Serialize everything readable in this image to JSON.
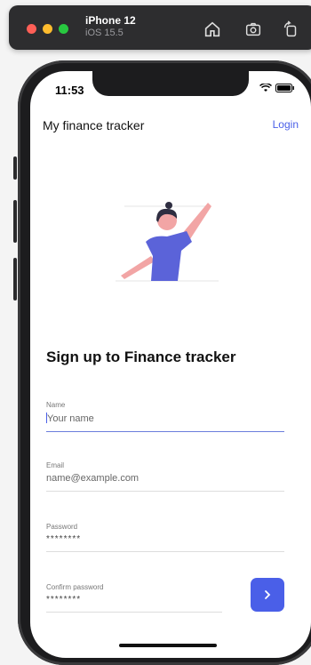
{
  "simulator": {
    "device_name": "iPhone 12",
    "os_version": "iOS 15.5",
    "toolbar_icons": [
      "home-icon",
      "screenshot-icon",
      "rotate-icon"
    ]
  },
  "status_bar": {
    "time": "11:53",
    "icons": [
      "wifi-icon",
      "battery-icon"
    ]
  },
  "header": {
    "title": "My finance tracker",
    "login_label": "Login"
  },
  "main": {
    "heading": "Sign up to Finance tracker",
    "fields": [
      {
        "label": "Name",
        "placeholder": "Your name",
        "value": ""
      },
      {
        "label": "Email",
        "placeholder": "name@example.com",
        "value": ""
      },
      {
        "label": "Password",
        "placeholder": "",
        "value": "********"
      },
      {
        "label": "Confirm password",
        "placeholder": "",
        "value": "********"
      }
    ],
    "next_icon": "chevron-right-icon"
  },
  "colors": {
    "accent": "#4a5fe8",
    "illustration_shirt": "#5b63d9",
    "illustration_skin": "#f2a5a5"
  }
}
